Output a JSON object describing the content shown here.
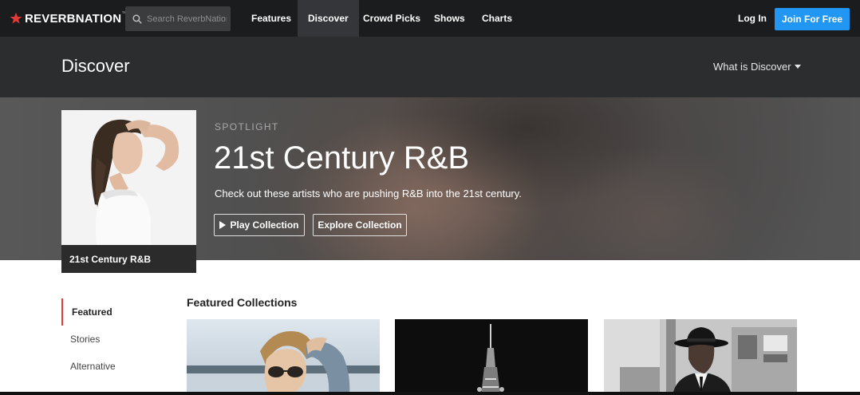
{
  "nav": {
    "brand": "REVERBNATION",
    "brand_tm": "™",
    "search_placeholder": "Search ReverbNation",
    "items": [
      {
        "label": "Features"
      },
      {
        "label": "Discover"
      },
      {
        "label": "Crowd Picks"
      },
      {
        "label": "Shows"
      },
      {
        "label": "Charts"
      }
    ],
    "active_item": "Discover",
    "login_label": "Log In",
    "join_label": "Join For Free",
    "accent_color": "#2196f3",
    "logo_color": "#e53935"
  },
  "header": {
    "title": "Discover",
    "what_is_label": "What is Discover"
  },
  "hero": {
    "eyebrow": "SPOTLIGHT",
    "title": "21st Century R&B",
    "subtitle": "Check out these artists who are pushing R&B into the 21st century.",
    "card_caption": "21st Century R&B",
    "play_label": "Play Collection",
    "explore_label": "Explore Collection"
  },
  "sidebar": {
    "items": [
      {
        "label": "Featured"
      },
      {
        "label": "Stories"
      },
      {
        "label": "Alternative"
      }
    ],
    "active_item": "Featured"
  },
  "featured": {
    "heading": "Featured Collections"
  }
}
